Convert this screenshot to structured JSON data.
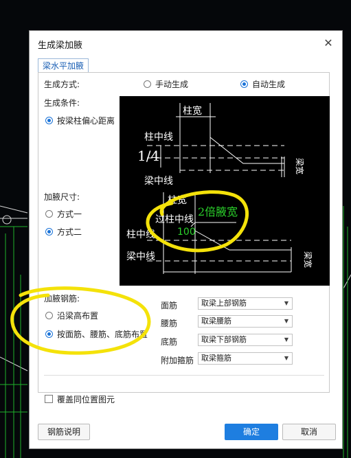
{
  "dialog": {
    "title": "生成梁加腋",
    "close_glyph": "✕"
  },
  "tab": {
    "label": "梁水平加腋"
  },
  "generate_mode": {
    "label": "生成方式:",
    "options": [
      {
        "label": "手动生成",
        "selected": false
      },
      {
        "label": "自动生成",
        "selected": true
      }
    ]
  },
  "generate_condition": {
    "label": "生成条件:",
    "option": {
      "label": "按梁柱偏心距离",
      "selected": true
    },
    "preview_labels": {
      "col_width": "柱宽",
      "col_center": "柱中线",
      "ratio": "1/4",
      "beam_center": "梁中线",
      "beam_side": "梁宽"
    }
  },
  "haunch_size": {
    "label": "加腋尺寸:",
    "options": [
      {
        "label": "方式一",
        "selected": false
      },
      {
        "label": "方式二",
        "selected": true
      }
    ],
    "preview_labels": {
      "col_width": "柱宽",
      "over_col_center": "过柱中线",
      "double_haunch": "2倍腋宽",
      "col_center": "柱中线",
      "offset": "100",
      "beam_center": "梁中线",
      "beam_side": "梁宽"
    }
  },
  "haunch_rebar": {
    "label": "加腋钢筋:",
    "options": [
      {
        "label": "沿梁高布置",
        "selected": false
      },
      {
        "label": "按面筋、腰筋、底筋布置",
        "selected": true
      }
    ],
    "rows": [
      {
        "label": "面筋",
        "value": "取梁上部钢筋"
      },
      {
        "label": "腰筋",
        "value": "取梁腰筋"
      },
      {
        "label": "底筋",
        "value": "取梁下部钢筋"
      },
      {
        "label": "附加箍筋",
        "value": "取梁箍筋"
      }
    ]
  },
  "overwrite": {
    "label": "覆盖同位置图元",
    "checked": false
  },
  "buttons": {
    "rebar_help": "钢筋说明",
    "ok": "确定",
    "cancel": "取消"
  },
  "colors": {
    "accent": "#1e7ee0",
    "annotation": "#f4e20a",
    "preview_text_green": "#2bd12b"
  }
}
